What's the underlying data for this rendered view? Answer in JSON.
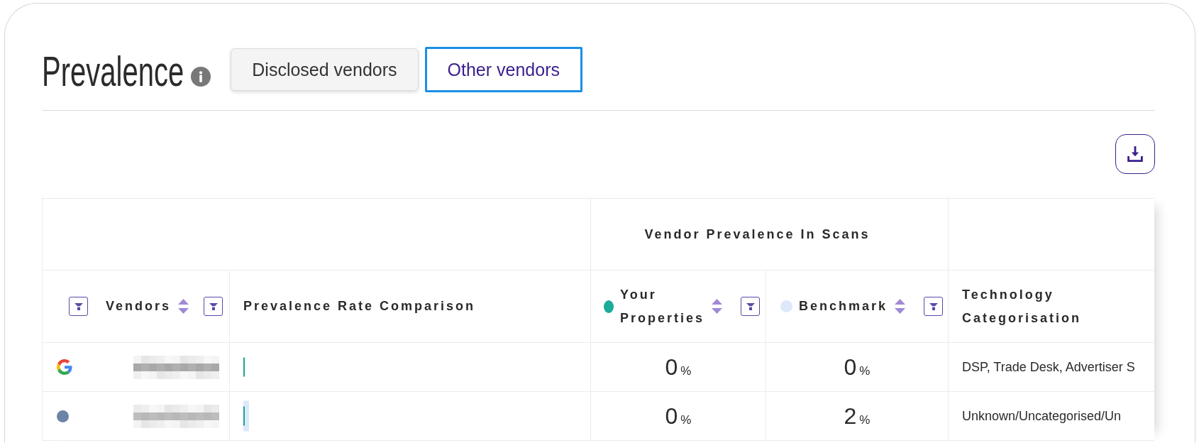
{
  "title": "Prevalence",
  "info_icon": true,
  "tabs": [
    {
      "label": "Disclosed vendors",
      "selected": false
    },
    {
      "label": "Other vendors",
      "selected": true
    }
  ],
  "toolbar": [
    {
      "kind": "download"
    }
  ],
  "table": {
    "column_group": "Vendor Prevalence In Scans",
    "columns": [
      {
        "label": "Vendors",
        "in_group": false,
        "leading_filter": true,
        "sortable": true,
        "filterable": true
      },
      {
        "label": "Prevalence Rate Comparison",
        "in_group": false,
        "leading_filter": false,
        "sortable": false,
        "filterable": false
      },
      {
        "label": "Your Properties",
        "in_group": true,
        "leading_filter": false,
        "color": "#1aab9b",
        "sortable": true,
        "filterable": true
      },
      {
        "label": "Benchmark",
        "in_group": true,
        "leading_filter": false,
        "color": "#dbe9fb",
        "sortable": true,
        "filterable": true
      },
      {
        "label": "Technology Categorisation",
        "in_group": false,
        "leading_filter": false,
        "sortable": false,
        "filterable": false
      }
    ],
    "rows": [
      {
        "kind": "logo",
        "name_redacted": true,
        "your_bar": {
          "level": 0
        },
        "benchmark_bar": {
          "level": 0
        },
        "your_properties": {
          "value": "0",
          "unit": "%"
        },
        "benchmark": {
          "value": "0",
          "unit": "%"
        },
        "technology": "DSP, Trade Desk, Advertiser S"
      },
      {
        "kind": "dot",
        "name_redacted": true,
        "your_bar": {
          "level": 0
        },
        "benchmark_bar": {
          "level": 0.02
        },
        "your_properties": {
          "value": "0",
          "unit": "%"
        },
        "benchmark": {
          "value": "2",
          "unit": "%"
        },
        "technology": "Unknown/Uncategorised/Un"
      }
    ]
  }
}
